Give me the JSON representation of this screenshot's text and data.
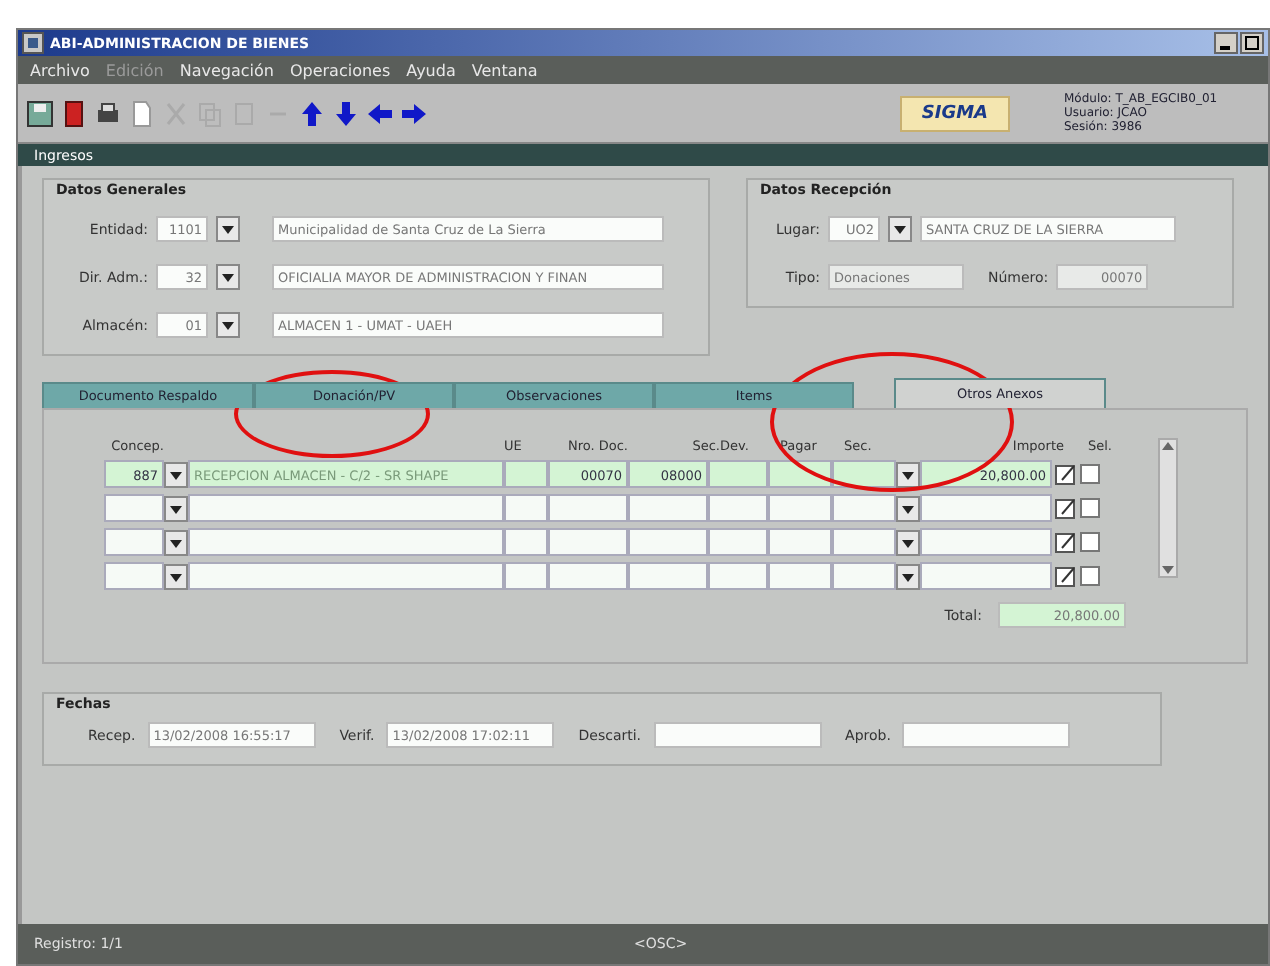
{
  "window": {
    "title": "ABI-ADMINISTRACION DE BIENES"
  },
  "menu": [
    "Archivo",
    "Edición",
    "Navegación",
    "Operaciones",
    "Ayuda",
    "Ventana"
  ],
  "toolbar": {
    "logo": "SIGMA",
    "info": [
      "Módulo: T_AB_EGCIB0_01",
      "Usuario: JCAO",
      "Sesión: 3986"
    ]
  },
  "form": {
    "title": "Ingresos"
  },
  "datos_generales": {
    "title": "Datos Generales",
    "fields": [
      {
        "label": "Entidad:",
        "code": "1101",
        "description": "Municipalidad de Santa Cruz de La Sierra"
      },
      {
        "label": "Dir. Adm.:",
        "code": "32",
        "description": "OFICIALIA MAYOR DE ADMINISTRACION Y FINAN"
      },
      {
        "label": "Almacén:",
        "code": "01",
        "description": "ALMACEN 1 - UMAT - UAEH"
      }
    ]
  },
  "datos_recepcion": {
    "title": "Datos Recepción",
    "lugar_label": "Lugar:",
    "lugar_code": "UO2",
    "lugar_name": "SANTA CRUZ DE LA SIERRA",
    "tipo_label": "Tipo:",
    "tipo": "Donaciones",
    "numero_label": "Número:",
    "numero": "00070"
  },
  "tabs": [
    {
      "label": "Documento Respaldo",
      "selected": false
    },
    {
      "label": "Donación/PV",
      "selected": false
    },
    {
      "label": "Observaciones",
      "selected": false
    },
    {
      "label": "Items",
      "selected": false
    },
    {
      "label": "Otros Anexos",
      "selected": true
    }
  ],
  "table": {
    "columns": [
      "Concep.",
      "UE",
      "Nro. Doc.",
      "Sec.",
      "Dev.",
      "Pagar",
      "Sec.",
      "Importe",
      "Sel."
    ],
    "rows": [
      {
        "selected": true,
        "checked": false,
        "concept": "887",
        "description": "RECEPCION ALMACEN - C/2 - SR SHAPE",
        "nro_doc": "00070",
        "sec": "08000",
        "importe": "20,800.00"
      },
      {
        "selected": false,
        "checked": false
      },
      {
        "selected": false,
        "checked": false
      },
      {
        "selected": false,
        "checked": false
      }
    ],
    "total_label": "Total:",
    "total": "20,800.00"
  },
  "fechas": {
    "title": "Fechas",
    "fields": [
      {
        "label": "Recep.",
        "value": "13/02/2008 16:55:17"
      },
      {
        "label": "Verif.",
        "value": "13/02/2008 17:02:11"
      },
      {
        "label": "Descarti."
      },
      {
        "label": "Aprob."
      }
    ]
  },
  "status_bar": {
    "record": "Registro: 1/1",
    "mode": "<OSC>"
  }
}
